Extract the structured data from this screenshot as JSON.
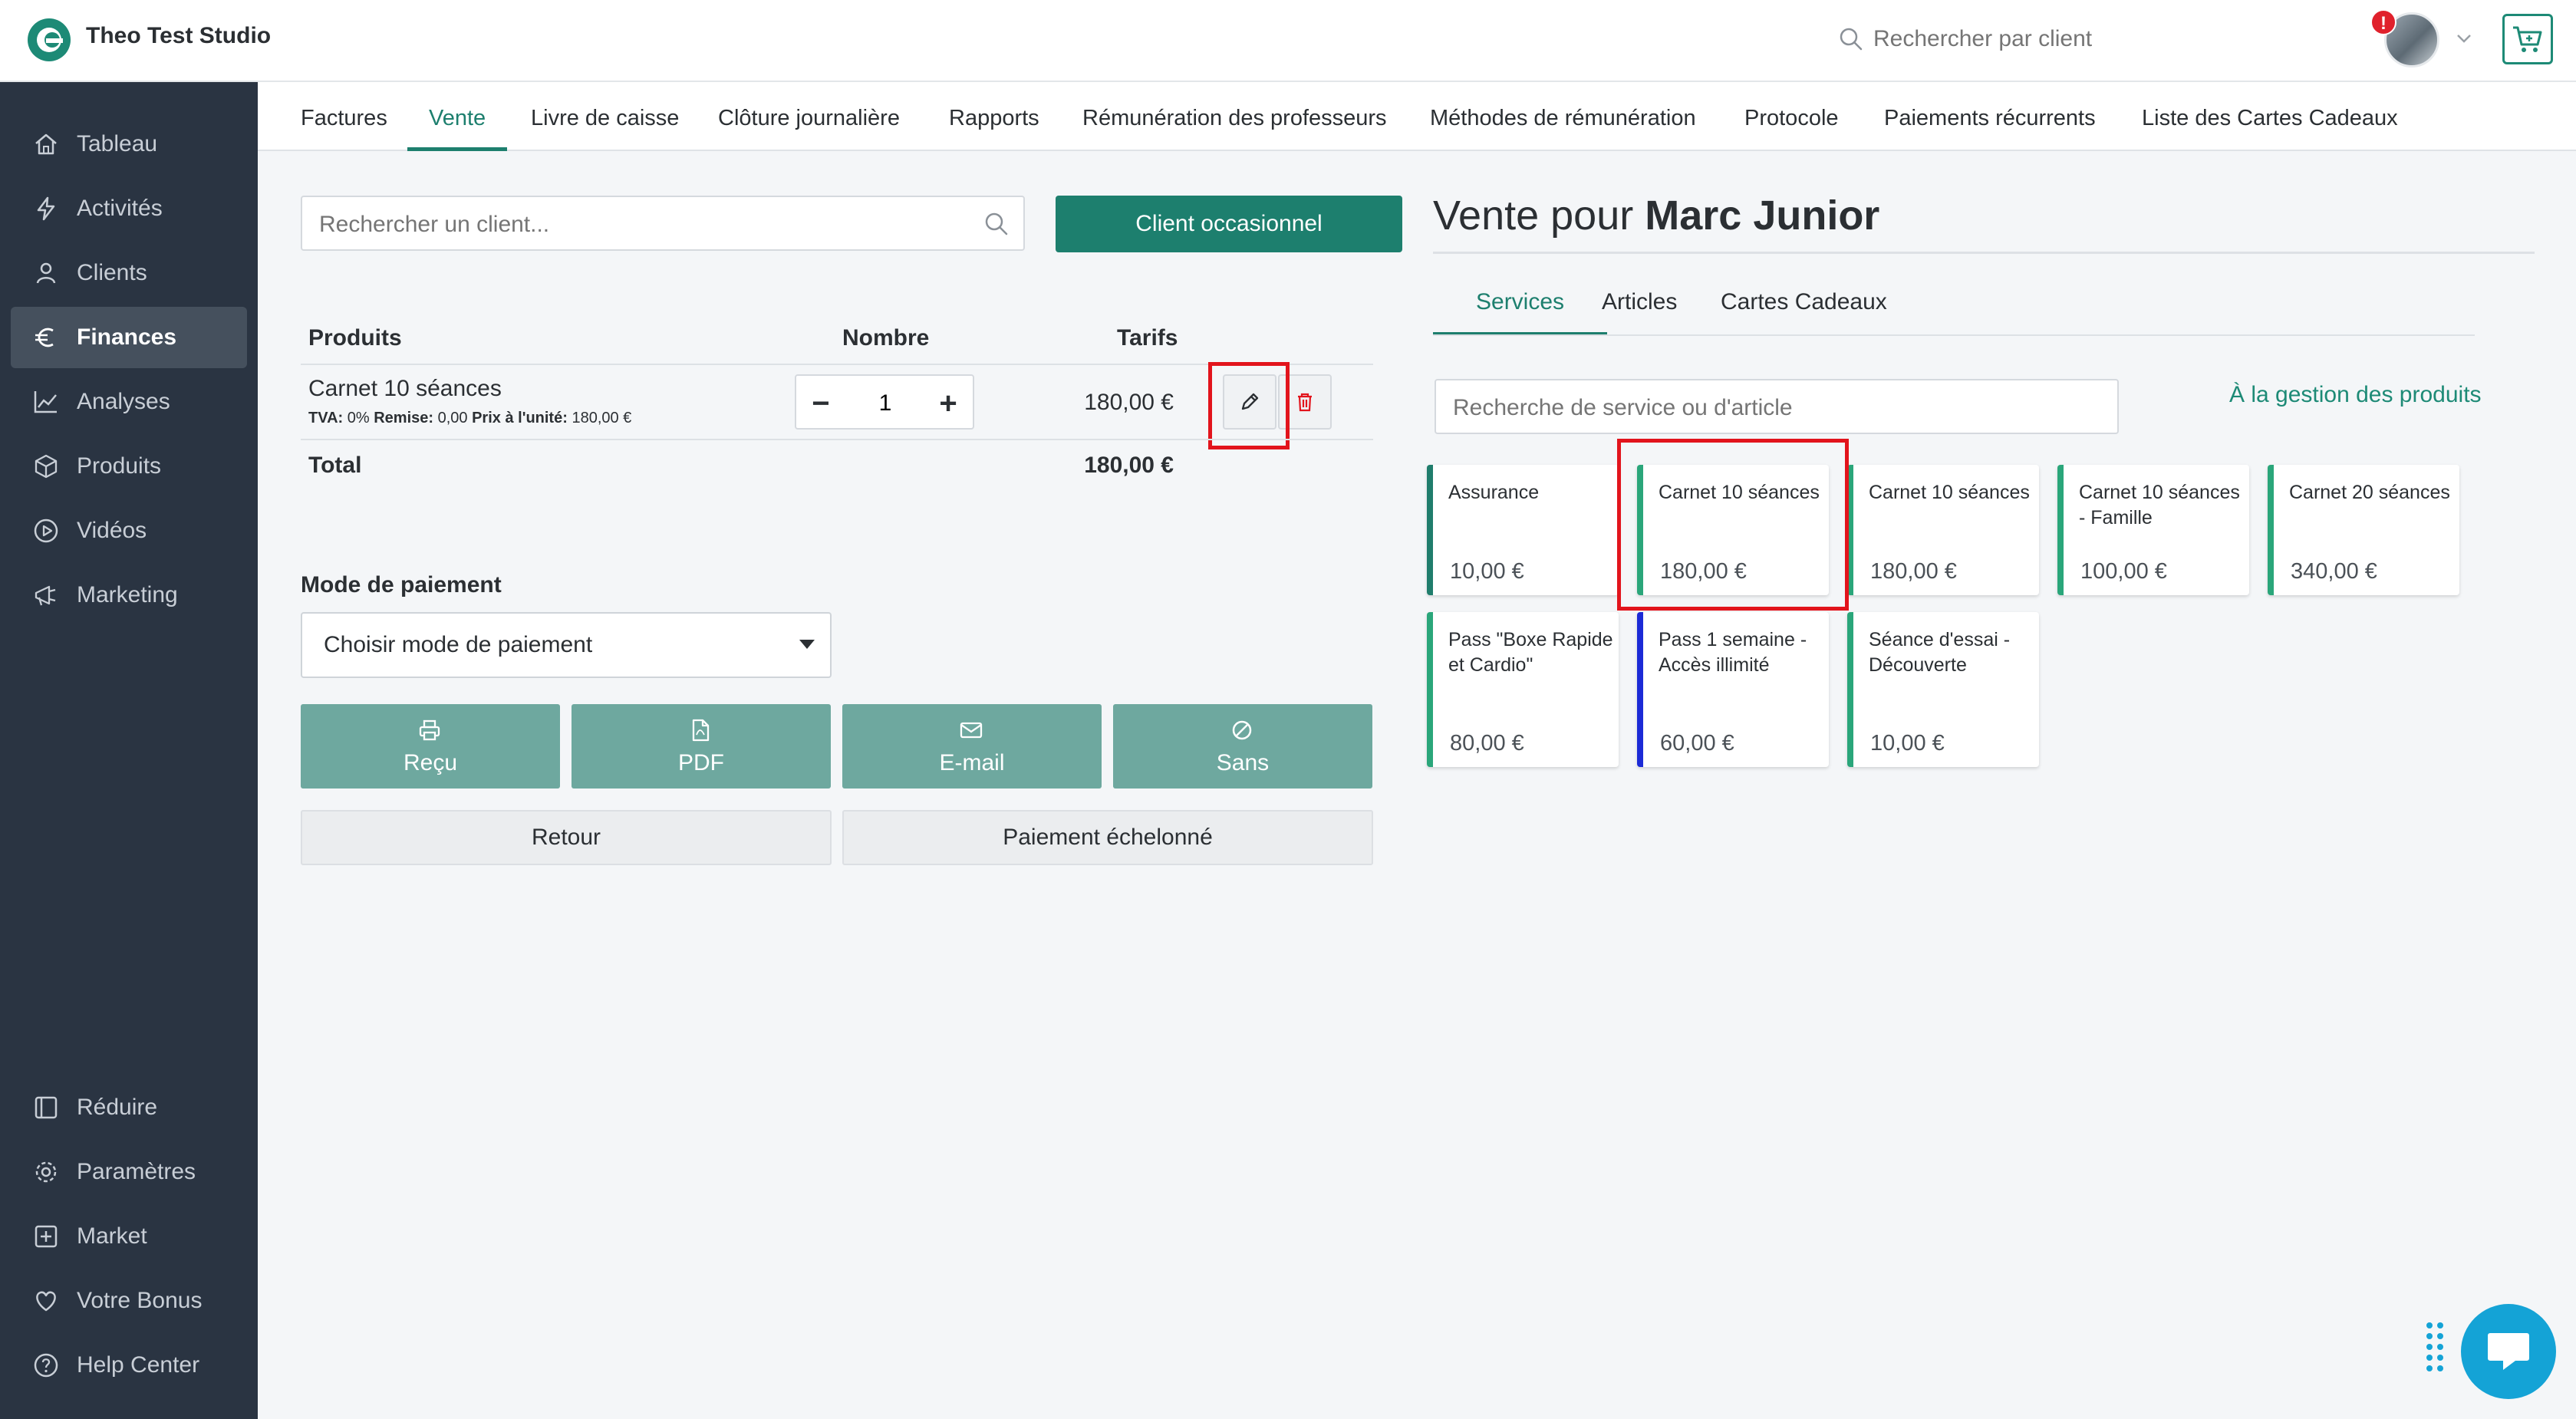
{
  "app": {
    "title": "Theo Test Studio"
  },
  "topbar": {
    "search_placeholder": "Rechercher par client",
    "notification_count": "!"
  },
  "sidebar": {
    "items": [
      {
        "label": "Tableau",
        "icon": "home-icon"
      },
      {
        "label": "Activités",
        "icon": "bolt-icon"
      },
      {
        "label": "Clients",
        "icon": "user-icon"
      },
      {
        "label": "Finances",
        "icon": "euro-icon"
      },
      {
        "label": "Analyses",
        "icon": "chart-icon"
      },
      {
        "label": "Produits",
        "icon": "box-icon"
      },
      {
        "label": "Vidéos",
        "icon": "play-icon"
      },
      {
        "label": "Marketing",
        "icon": "megaphone-icon"
      }
    ],
    "bottom_items": [
      {
        "label": "Réduire",
        "icon": "collapse-icon"
      },
      {
        "label": "Paramètres",
        "icon": "gear-icon"
      },
      {
        "label": "Market",
        "icon": "plus-square-icon"
      },
      {
        "label": "Votre Bonus",
        "icon": "heart-icon"
      },
      {
        "label": "Help Center",
        "icon": "help-icon"
      }
    ],
    "active": "Finances"
  },
  "subnav": {
    "tabs": [
      "Factures",
      "Vente",
      "Livre de caisse",
      "Clôture journalière",
      "Rapports",
      "Rémunération des professeurs",
      "Méthodes de rémunération",
      "Protocole",
      "Paiements récurrents",
      "Liste des Cartes Cadeaux"
    ],
    "active": "Vente"
  },
  "sale": {
    "client_search_placeholder": "Rechercher un client...",
    "occasional_client_label": "Client occasionnel",
    "columns": {
      "products": "Produits",
      "quantity": "Nombre",
      "price": "Tarifs"
    },
    "line": {
      "name": "Carnet 10 séances",
      "vat_label": "TVA:",
      "vat_value": "0%",
      "discount_label": "Remise:",
      "discount_value": "0,00",
      "unit_price_label": "Prix à l'unité:",
      "unit_price_value": "180,00 €",
      "quantity": "1",
      "price": "180,00 €"
    },
    "total_label": "Total",
    "total_value": "180,00 €",
    "payment_label": "Mode de paiement",
    "payment_selected": "Choisir mode de paiement",
    "output_buttons": [
      {
        "label": "Reçu",
        "icon": "printer-icon"
      },
      {
        "label": "PDF",
        "icon": "pdf-icon"
      },
      {
        "label": "E-mail",
        "icon": "envelope-icon"
      },
      {
        "label": "Sans",
        "icon": "ban-icon"
      }
    ],
    "back_label": "Retour",
    "installment_label": "Paiement échelonné"
  },
  "panel": {
    "title_prefix": "Vente pour",
    "client_name": "Marc Junior",
    "tabs": [
      "Services",
      "Articles",
      "Cartes Cadeaux"
    ],
    "active_tab": "Services",
    "search_placeholder": "Recherche de service ou d'article",
    "manage_link": "À la gestion des produits",
    "cards": [
      {
        "name": "Assurance",
        "price": "10,00 €",
        "accent": "#1f7d6c"
      },
      {
        "name": "Carnet 10 séances",
        "price": "180,00 €",
        "accent": "#2aa67a"
      },
      {
        "name": "Carnet 10 séances",
        "price": "180,00 €",
        "accent": "#2aa67a"
      },
      {
        "name": "Carnet 10 séances - Famille",
        "price": "100,00 €",
        "accent": "#2aa67a"
      },
      {
        "name": "Carnet 20 séances",
        "price": "340,00 €",
        "accent": "#2aa67a"
      },
      {
        "name": "Pass \"Boxe Rapide et Cardio\"",
        "price": "80,00 €",
        "accent": "#2aa67a"
      },
      {
        "name": "Pass 1 semaine - Accès illimité",
        "price": "60,00 €",
        "accent": "#1c2bd6"
      },
      {
        "name": "Séance d'essai - Découverte",
        "price": "10,00 €",
        "accent": "#2aa67a"
      }
    ]
  },
  "colors": {
    "brand": "#1d7f6e",
    "sidebar_bg": "#2a3442",
    "output_button": "#6ea89f",
    "highlight": "#e2141c",
    "chat": "#14a3d6"
  }
}
